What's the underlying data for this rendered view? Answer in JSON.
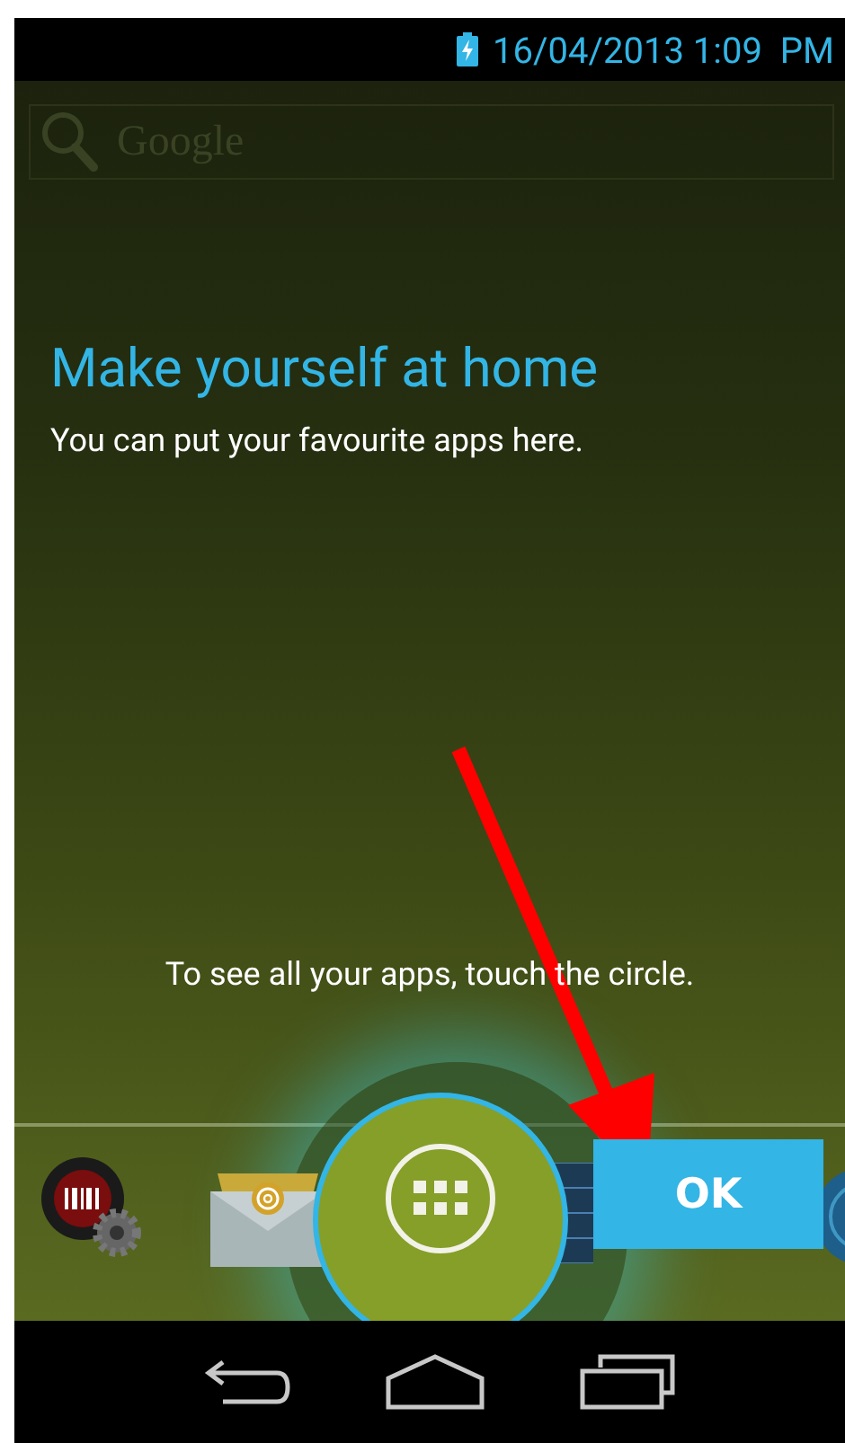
{
  "status_bar": {
    "time": "16/04/2013 1:09  PM"
  },
  "search_bar": {
    "placeholder": "Google"
  },
  "intro": {
    "title": "Make yourself at home",
    "subtitle": "You can put your favourite apps here."
  },
  "hint": "To see all your apps, touch the circle.",
  "ok_button": {
    "label": "OK"
  }
}
